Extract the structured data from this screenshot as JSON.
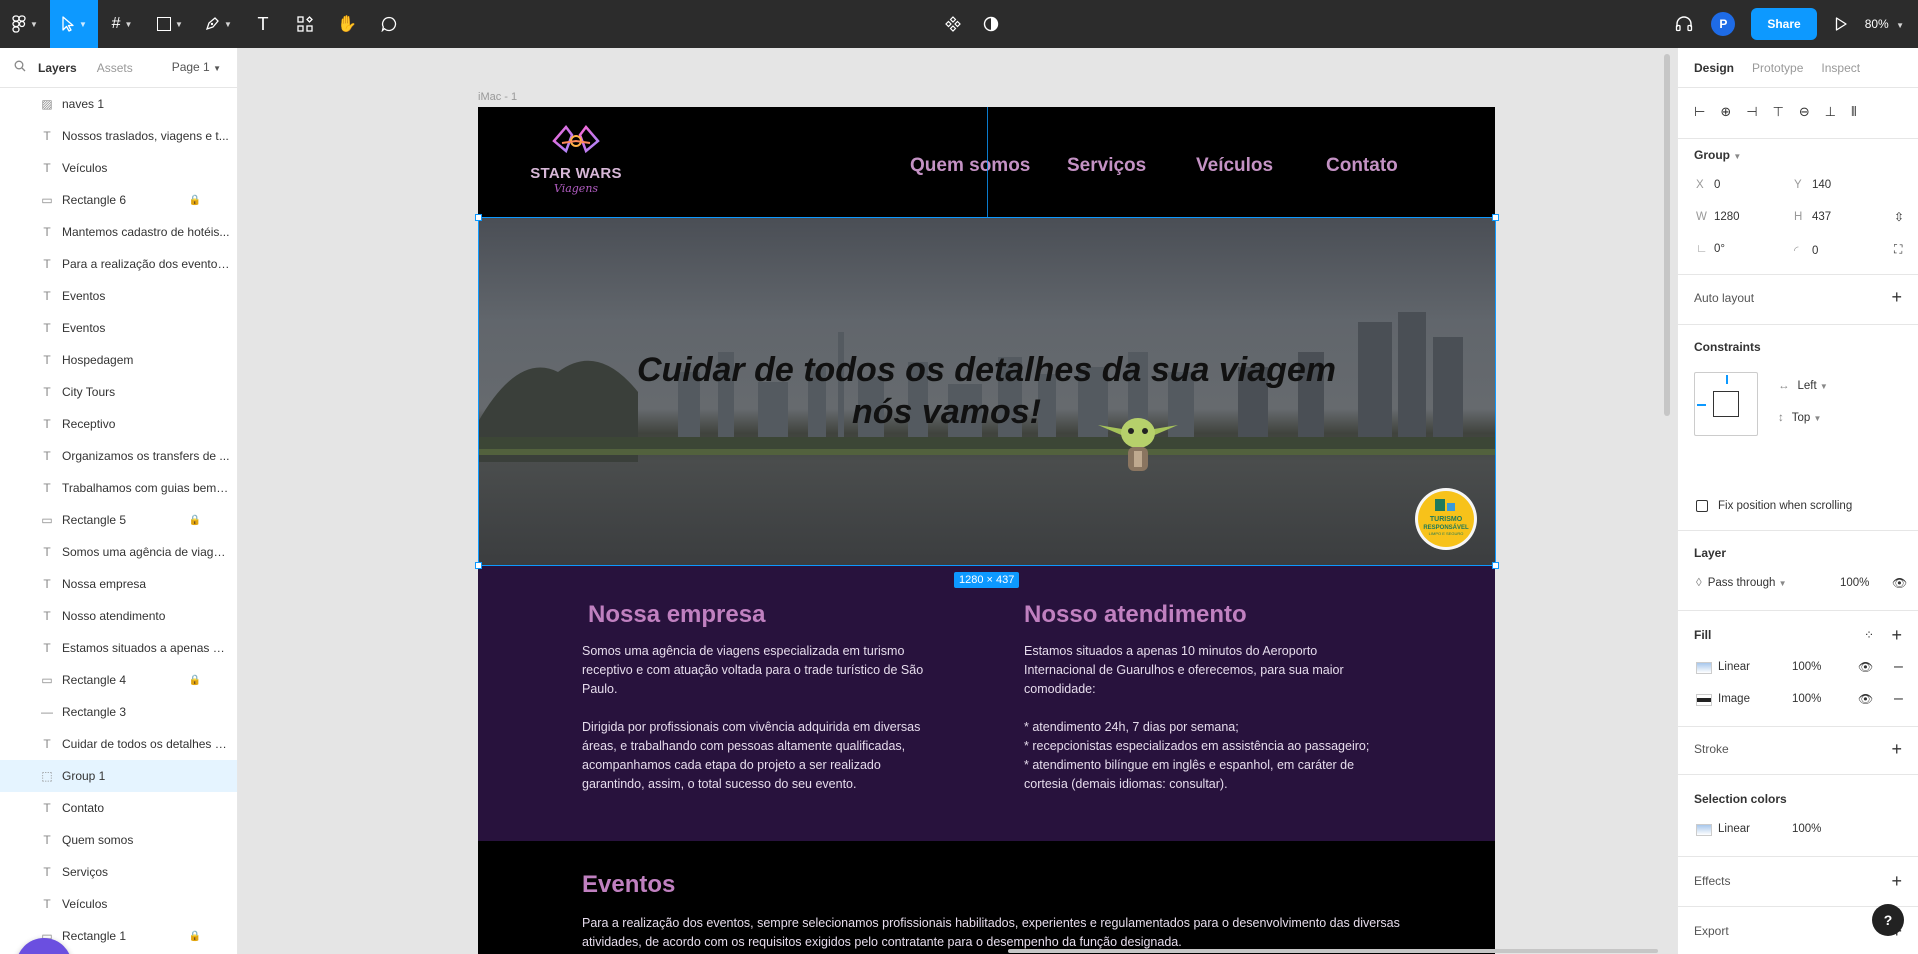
{
  "toolbar": {
    "zoom": "80%",
    "share_label": "Share",
    "avatar_initial": "P"
  },
  "left_panel": {
    "tabs": [
      "Layers",
      "Assets"
    ],
    "page": "Page 1",
    "layers": [
      {
        "icon": "image-icon",
        "name": "naves 1",
        "locked": false
      },
      {
        "icon": "text-icon",
        "name": "Nossos traslados, viagens e t...",
        "locked": false
      },
      {
        "icon": "text-icon",
        "name": "Veículos",
        "locked": false
      },
      {
        "icon": "rectangle-icon",
        "name": "Rectangle 6",
        "locked": true
      },
      {
        "icon": "text-icon",
        "name": "Mantemos cadastro de hotéis...",
        "locked": false
      },
      {
        "icon": "text-icon",
        "name": "Para a realização dos eventos...",
        "locked": false
      },
      {
        "icon": "text-icon",
        "name": "Eventos",
        "locked": false
      },
      {
        "icon": "text-icon",
        "name": "Eventos",
        "locked": false
      },
      {
        "icon": "text-icon",
        "name": "Hospedagem",
        "locked": false
      },
      {
        "icon": "text-icon",
        "name": "City Tours",
        "locked": false
      },
      {
        "icon": "text-icon",
        "name": "Receptivo",
        "locked": false
      },
      {
        "icon": "text-icon",
        "name": "Organizamos os transfers de ...",
        "locked": false
      },
      {
        "icon": "text-icon",
        "name": "Trabalhamos com guias bem t...",
        "locked": false
      },
      {
        "icon": "rectangle-icon",
        "name": "Rectangle 5",
        "locked": true
      },
      {
        "icon": "text-icon",
        "name": "Somos uma agência de viage...",
        "locked": false
      },
      {
        "icon": "text-icon",
        "name": "Nossa empresa",
        "locked": false
      },
      {
        "icon": "text-icon",
        "name": "Nosso atendimento",
        "locked": false
      },
      {
        "icon": "text-icon",
        "name": "Estamos situados a apenas 10...",
        "locked": false
      },
      {
        "icon": "rectangle-icon",
        "name": "Rectangle 4",
        "locked": true
      },
      {
        "icon": "line-icon",
        "name": "Rectangle 3",
        "locked": false
      },
      {
        "icon": "text-icon",
        "name": "Cuidar de todos os detalhes d...",
        "locked": false
      },
      {
        "icon": "group-icon",
        "name": "Group 1",
        "locked": false,
        "selected": true
      },
      {
        "icon": "text-icon",
        "name": "Contato",
        "locked": false
      },
      {
        "icon": "text-icon",
        "name": "Quem somos",
        "locked": false
      },
      {
        "icon": "text-icon",
        "name": "Serviços",
        "locked": false
      },
      {
        "icon": "text-icon",
        "name": "Veículos",
        "locked": false
      },
      {
        "icon": "rectangle-icon",
        "name": "Rectangle 1",
        "locked": true
      }
    ]
  },
  "canvas": {
    "frame_label": "iMac - 1",
    "dimension_badge": "1280 × 437",
    "site": {
      "logo_title": "STAR WARS",
      "logo_sub": "Viagens",
      "nav": [
        "Quem somos",
        "Serviços",
        "Veículos",
        "Contato"
      ],
      "hero_line1": "Cuidar de todos os detalhes da sua viagem",
      "hero_line2": "nós vamos!",
      "seal_line1": "TURISMO",
      "seal_line2": "RESPONSÁVEL",
      "seal_line3": "LIMPO E SEGURO",
      "col1_title": "Nossa empresa",
      "col1_text": "Somos uma agência de viagens especializada em turismo\nreceptivo e com atuação voltada para o trade turístico de São\nPaulo.\n\nDirigida por profissionais com vivência adquirida em diversas\náreas, e trabalhando com pessoas altamente qualificadas,\nacompanhamos cada etapa do projeto a ser realizado\ngarantindo, assim, o total sucesso do seu evento.",
      "col2_title": "Nosso atendimento",
      "col2_text": "Estamos situados a apenas 10 minutos do Aeroporto\nInternacional de Guarulhos e oferecemos, para sua maior\ncomodidade:\n\n* atendimento 24h, 7 dias por semana;\n* recepcionistas especializados em assistência ao passageiro;\n* atendimento bilíngue em inglês e espanhol, em caráter de\ncortesia (demais idiomas: consultar).",
      "events_title": "Eventos",
      "events_text": "Para a realização dos eventos, sempre selecionamos profissionais habilitados, experientes e regulamentados para o desenvolvimento das diversas\natividades, de acordo com os requisitos exigidos pelo contratante para o desempenho da função designada."
    }
  },
  "right_panel": {
    "tabs": [
      "Design",
      "Prototype",
      "Inspect"
    ],
    "group_label": "Group",
    "x_label": "X",
    "x": "0",
    "y_label": "Y",
    "y": "140",
    "w_label": "W",
    "w": "1280",
    "h_label": "H",
    "h": "437",
    "rotation": "0°",
    "radius": "0",
    "auto_layout": "Auto layout",
    "constraints": "Constraints",
    "constraint_h": "Left",
    "constraint_v": "Top",
    "fix_position": "Fix position when scrolling",
    "layer": "Layer",
    "blend": "Pass through",
    "layer_opacity": "100%",
    "fill": "Fill",
    "fills": [
      {
        "type": "Linear",
        "opacity": "100%"
      },
      {
        "type": "Image",
        "opacity": "100%"
      }
    ],
    "stroke": "Stroke",
    "selection_colors": "Selection colors",
    "sel_color_type": "Linear",
    "sel_color_opacity": "100%",
    "effects": "Effects",
    "export": "Export",
    "help": "?"
  },
  "colors": {
    "accent": "#0d99ff",
    "toolbar_bg": "#2c2c2c",
    "nav_pink": "#c492c4",
    "section_purple": "#28123d"
  }
}
